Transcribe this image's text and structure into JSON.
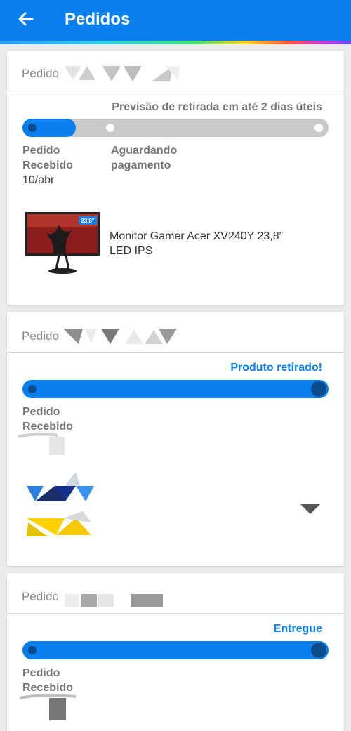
{
  "header": {
    "title": "Pedidos",
    "accent_color": "#0a7fef"
  },
  "orders": [
    {
      "label": "Pedido",
      "status_text": "Previsão de retirada em até 2 dias úteis",
      "status_color": "#777777",
      "progress": 0.17,
      "steps": [
        {
          "title_line1": "Pedido",
          "title_line2": "Recebido",
          "date": "10/abr"
        },
        {
          "title_line1": "Aguardando",
          "title_line2": "pagamento",
          "date": ""
        }
      ],
      "product": {
        "name_line1": "Monitor Gamer Acer XV240Y 23,8”",
        "name_line2": "LED IPS",
        "badge": "23,8\""
      }
    },
    {
      "label": "Pedido",
      "status_text": "Produto retirado!",
      "status_color": "#0a7fef",
      "progress": 1.0,
      "steps": [
        {
          "title_line1": "Pedido",
          "title_line2": "Recebido",
          "date": ""
        }
      ]
    },
    {
      "label": "Pedido",
      "status_text": "Entregue",
      "status_color": "#0a7fef",
      "progress": 1.0,
      "steps": [
        {
          "title_line1": "Pedido",
          "title_line2": "Recebido",
          "date": ""
        }
      ]
    }
  ]
}
